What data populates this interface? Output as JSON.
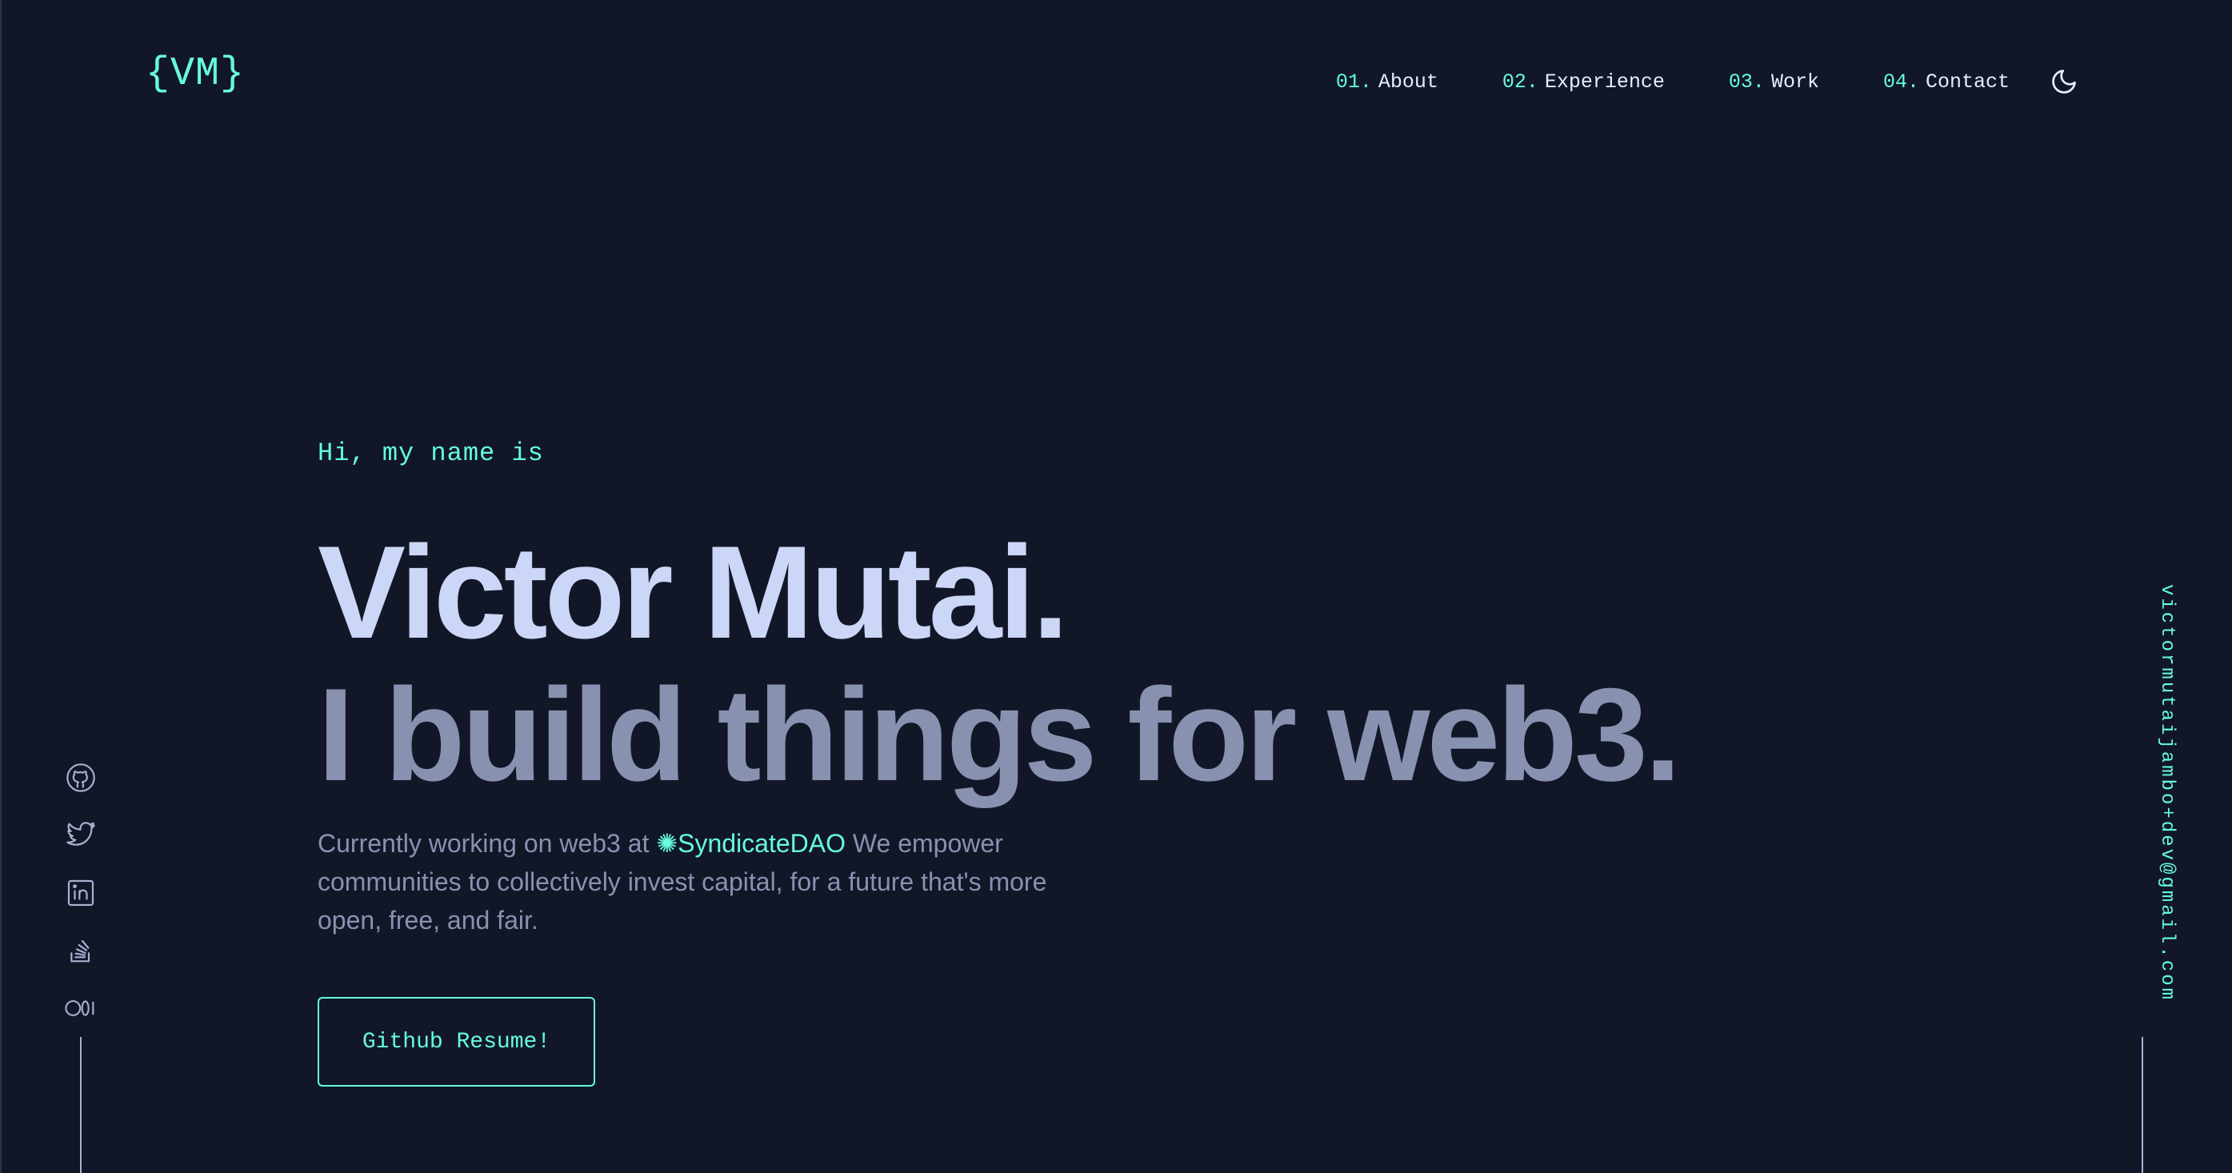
{
  "header": {
    "logo_open": "{",
    "logo_text": "VM",
    "logo_close": "}",
    "nav": [
      {
        "num": "01.",
        "label": "About"
      },
      {
        "num": "02.",
        "label": "Experience"
      },
      {
        "num": "03.",
        "label": "Work"
      },
      {
        "num": "04.",
        "label": "Contact"
      }
    ],
    "theme_icon": "moon-icon"
  },
  "hero": {
    "greeting": "Hi, my name is",
    "name": "Victor Mutai.",
    "tagline": "I build things for web3.",
    "blurb_before": "Currently working on web3 at ",
    "company": "✺SyndicateDAO",
    "blurb_after": " We empower communities to collectively invest capital, for a future that's more open, free, and fair.",
    "cta_label": "Github Resume!"
  },
  "socials": [
    "github-icon",
    "twitter-icon",
    "linkedin-icon",
    "stackoverflow-icon",
    "medium-icon"
  ],
  "email": "victormutaijambo+dev@gmail.com",
  "colors": {
    "background": "#121728",
    "accent": "#64ffda",
    "heading": "#ccd6f6",
    "muted": "#8892b0"
  }
}
